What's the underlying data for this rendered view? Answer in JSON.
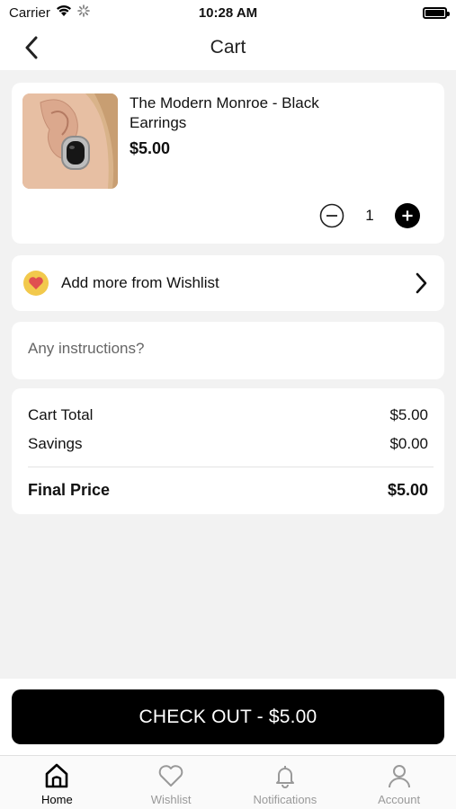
{
  "status_bar": {
    "carrier": "Carrier",
    "time": "10:28 AM"
  },
  "nav": {
    "title": "Cart",
    "back_icon": "chevron-left-icon"
  },
  "cart_item": {
    "name": "The Modern Monroe - Black Earrings",
    "price": "$5.00",
    "quantity": "1",
    "image_icon": "earring-product-image"
  },
  "wishlist": {
    "label": "Add more from Wishlist",
    "icon": "heart-icon",
    "badge_color": "#f2c94c",
    "heart_color": "#e05050"
  },
  "instructions": {
    "placeholder": "Any instructions?",
    "value": ""
  },
  "totals": {
    "cart_total_label": "Cart Total",
    "cart_total_value": "$5.00",
    "savings_label": "Savings",
    "savings_value": "$0.00",
    "final_label": "Final Price",
    "final_value": "$5.00"
  },
  "checkout": {
    "label": "CHECK OUT - $5.00"
  },
  "tabs": [
    {
      "label": "Home",
      "icon": "home-icon",
      "active": true
    },
    {
      "label": "Wishlist",
      "icon": "heart-icon",
      "active": false
    },
    {
      "label": "Notifications",
      "icon": "bell-icon",
      "active": false
    },
    {
      "label": "Account",
      "icon": "user-icon",
      "active": false
    }
  ],
  "colors": {
    "accent": "#000000",
    "background": "#f2f2f2",
    "inactive_tab": "#999999"
  }
}
